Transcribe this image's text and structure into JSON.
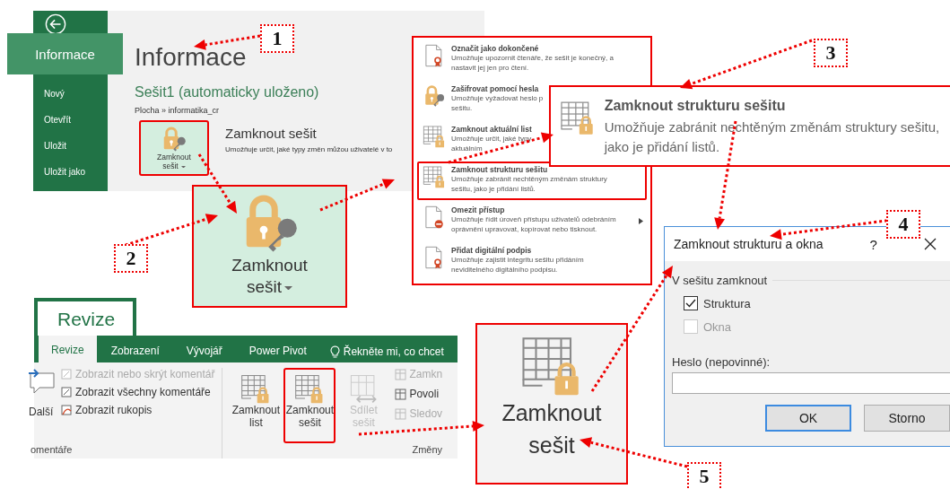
{
  "backstage": {
    "nav": [
      {
        "label": "Informace",
        "selected": true
      },
      {
        "label": "Nový",
        "selected": false
      },
      {
        "label": "Otevřít",
        "selected": false
      },
      {
        "label": "Uložit",
        "selected": false
      },
      {
        "label": "Uložit jako",
        "selected": false
      }
    ],
    "title": "Informace",
    "workbook": "Sešit1 (automaticky uloženo)",
    "path": "Plocha » informatika_cr",
    "protect_button": {
      "line1": "Zamknout",
      "line2": "sešit"
    },
    "protect_title": "Zamknout sešit",
    "protect_description": "Umožňuje určit, jaké typy změn můžou uživatelé v to"
  },
  "zoomed_button": {
    "line1": "Zamknout",
    "line2": "sešit"
  },
  "protect_menu": {
    "items": [
      {
        "kind": "mark-final",
        "title": "Označit jako dokončené",
        "description_lines": [
          "Umožňuje upozornit čtenáře, že sešit je konečný, a",
          "nastavit jej jen pro čtení."
        ],
        "highlighted": false,
        "submenu": false
      },
      {
        "kind": "encrypt",
        "title": "Zašifrovat pomocí hesla",
        "description_lines": [
          "Umožňuje vyžadovat heslo p",
          "sešitu."
        ],
        "highlighted": false,
        "submenu": false
      },
      {
        "kind": "protect-sheet",
        "title": "Zamknout aktuální list",
        "description_lines": [
          "Umožňuje určit, jaké typy",
          "aktuálním"
        ],
        "highlighted": false,
        "submenu": false
      },
      {
        "kind": "protect-structure",
        "title": "Zamknout strukturu sešitu",
        "description_lines": [
          "Umožňuje zabránit nechtěným změnám struktury",
          "sešitu, jako je přidání listů."
        ],
        "highlighted": true,
        "submenu": false
      },
      {
        "kind": "restrict",
        "title": "Omezit přístup",
        "description_lines": [
          "Umožňuje řídit úroveň přístupu uživatelů odebráním",
          "oprávnění upravovat, kopírovat nebo tisknout."
        ],
        "highlighted": false,
        "submenu": true
      },
      {
        "kind": "signature",
        "title": "Přidat digitální podpis",
        "description_lines": [
          "Umožňuje zajistit integritu sešitu přidáním",
          "neviditelného digitálního podpisu."
        ],
        "highlighted": false,
        "submenu": false
      }
    ]
  },
  "tooltip": {
    "title": "Zamknout strukturu sešitu",
    "description": "Umožňuje zabránit nechtěným změnám struktury sešitu, jako je přidání listů."
  },
  "dialog": {
    "title": "Zamknout strukturu a okna",
    "help": "?",
    "group": "V sešitu zamknout",
    "checkboxes": [
      {
        "label": "Struktura",
        "checked": true,
        "disabled": false
      },
      {
        "label": "Okna",
        "checked": false,
        "disabled": true
      }
    ],
    "password_label": "Heslo (nepovinné):",
    "buttons": [
      {
        "label": "OK",
        "default": true
      },
      {
        "label": "Storno",
        "default": false
      }
    ]
  },
  "ribbon": {
    "big_tab": "Revize",
    "tabs": [
      {
        "label": "Revize",
        "selected": true
      },
      {
        "label": "Zobrazení",
        "selected": false
      },
      {
        "label": "Vývojář",
        "selected": false
      },
      {
        "label": "Power Pivot",
        "selected": false
      }
    ],
    "tell_me": "Řekněte mi, co chcet",
    "next_comment": "Další",
    "comment_commands": [
      {
        "label": "Zobrazit nebo skrýt komentář",
        "disabled": true
      },
      {
        "label": "Zobrazit všechny komentáře",
        "disabled": false
      },
      {
        "label": "Zobrazit rukopis",
        "disabled": false
      }
    ],
    "comments_group": "omentáře",
    "change_buttons": [
      {
        "line1": "Zamknout",
        "line2": "list",
        "disabled": false,
        "highlighted": false
      },
      {
        "line1": "Zamknout",
        "line2": "sešit",
        "disabled": false,
        "highlighted": true
      },
      {
        "line1": "Sdílet",
        "line2": "sešit",
        "disabled": true,
        "highlighted": false
      }
    ],
    "change_commands": [
      {
        "label": "Zamkn",
        "disabled": true
      },
      {
        "label": "Povoli",
        "disabled": false
      },
      {
        "label": "Sledov",
        "disabled": true
      }
    ],
    "changes_group": "Změny"
  },
  "zoomed_ribbon_button": {
    "line1": "Zamknout",
    "line2": "sešit"
  },
  "step_labels": [
    "1",
    "2",
    "3",
    "4",
    "5"
  ]
}
